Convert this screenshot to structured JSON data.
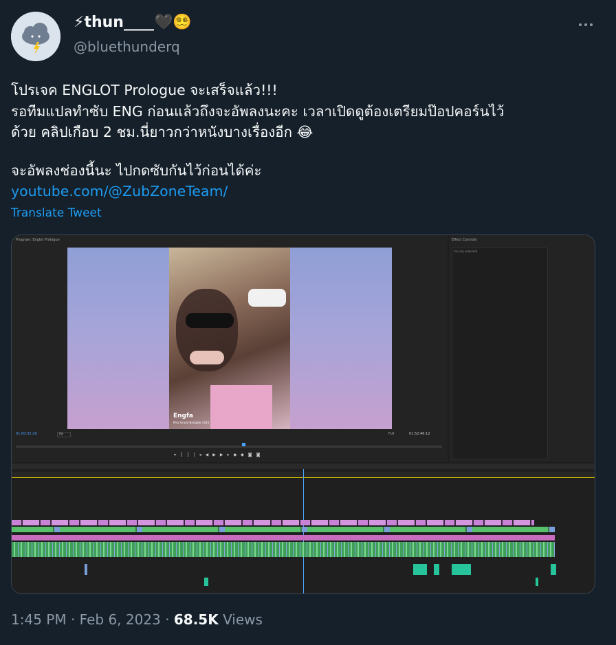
{
  "user": {
    "display_name": "⚡thun____🖤😵‍💫",
    "handle": "@bluethunderq"
  },
  "tweet": {
    "lines": [
      "โปรเจค ENGLOT Prologue จะเสร็จแล้ว!!!",
      "รอทีมแปลทำซับ ENG ก่อนแล้วถึงจะอัพลงนะคะ เวลาเปิดดูต้องเตรียมป๊อปคอร์นไว้",
      "ด้วย คลิปเกือบ 2 ชม.นี่ยาวกว่าหนังบางเรื่องอีก 😂",
      "จะอัพลงช่องนี้นะ ไปกดซับกันไว้ก่อนได้ค่ะ"
    ],
    "link": "youtube.com/@ZubZoneTeam/",
    "translate_label": "Translate Tweet"
  },
  "media": {
    "sequence_title": "Program: Englot Prologue",
    "effect_controls_title": "Effect Controls",
    "no_clip": "(no clip selected)",
    "timecode_current": "01:00:32:29",
    "timecode_end": "01:52:46:12",
    "fit_label": "Fit",
    "full_label": "Full",
    "watermark_title": "Engfa",
    "watermark_sub": "Miss Grand Bangkok 2023"
  },
  "footer": {
    "time": "1:45 PM",
    "sep": "·",
    "date": "Feb 6, 2023",
    "views_count": "68.5K",
    "views_label": "Views"
  }
}
